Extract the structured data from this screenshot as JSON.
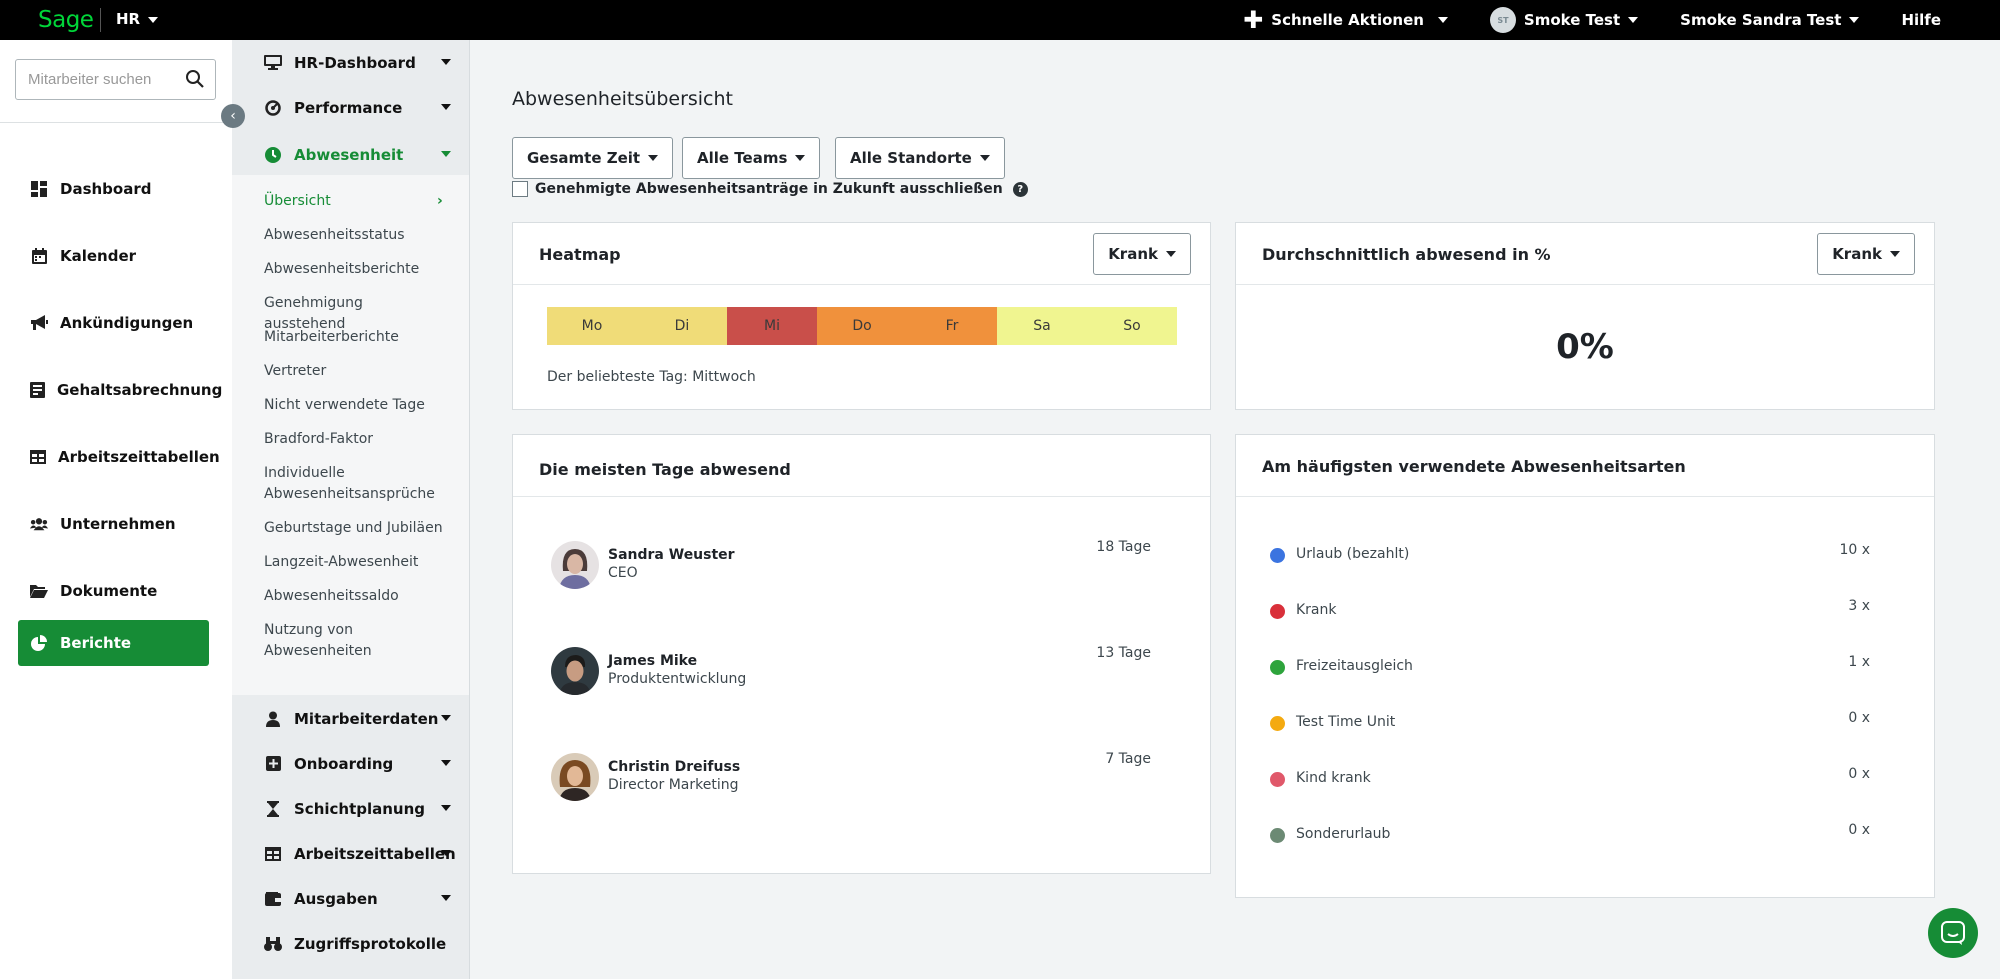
{
  "topbar": {
    "logo": "Sage",
    "module": "HR",
    "quick_actions": "Schnelle Aktionen",
    "company_initials": "ST",
    "company": "Smoke Test",
    "user": "Smoke Sandra Test",
    "help": "Hilfe"
  },
  "search": {
    "placeholder": "Mitarbeiter suchen"
  },
  "leftnav": {
    "items": [
      {
        "label": "Dashboard"
      },
      {
        "label": "Kalender"
      },
      {
        "label": "Ankündigungen"
      },
      {
        "label": "Gehaltsabrechnung"
      },
      {
        "label": "Arbeitszeittabellen"
      },
      {
        "label": "Unternehmen"
      },
      {
        "label": "Dokumente"
      },
      {
        "label": "Berichte"
      }
    ]
  },
  "subnav": {
    "hr_dashboard": "HR-Dashboard",
    "performance": "Performance",
    "absence": "Abwesenheit",
    "links": [
      "Übersicht",
      "Abwesenheitsstatus",
      "Abwesenheitsberichte",
      "Genehmigung ausstehend",
      "Mitarbeiterberichte",
      "Vertreter",
      "Nicht verwendete Tage",
      "Bradford-Faktor",
      "Individuelle Abwesenheitsansprüche",
      "Geburtstage und Jubiläen",
      "Langzeit-Abwesenheit",
      "Abwesenheitssaldo",
      "Nutzung von Abwesenheiten"
    ],
    "employee_data": "Mitarbeiterdaten",
    "onboarding": "Onboarding",
    "shift_planning": "Schichtplanung",
    "timesheets": "Arbeitszeittabellen",
    "expenses": "Ausgaben",
    "access_logs": "Zugriffsprotokolle"
  },
  "main": {
    "title": "Abwesenheitsübersicht",
    "filters": {
      "time": "Gesamte Zeit",
      "teams": "Alle Teams",
      "locations": "Alle Standorte"
    },
    "exclude_label": "Genehmigte Abwesenheitsanträge in Zukunft ausschließen",
    "heatmap": {
      "title": "Heatmap",
      "select": "Krank",
      "days": [
        {
          "label": "Mo",
          "color": "#f0dc78"
        },
        {
          "label": "Di",
          "color": "#f0dc78"
        },
        {
          "label": "Mi",
          "color": "#c94f4a"
        },
        {
          "label": "Do",
          "color": "#f0913c"
        },
        {
          "label": "Fr",
          "color": "#f0913c"
        },
        {
          "label": "Sa",
          "color": "#f0f590"
        },
        {
          "label": "So",
          "color": "#f0f590"
        }
      ],
      "favorite": "Der beliebteste Tag: Mittwoch"
    },
    "average": {
      "title": "Durchschnittlich abwesend in %",
      "select": "Krank",
      "value": "0%"
    },
    "most_days": {
      "title": "Die meisten Tage abwesend",
      "people": [
        {
          "name": "Sandra Weuster",
          "role": "CEO",
          "days": "18 Tage"
        },
        {
          "name": "James Mike",
          "role": "Produktentwicklung",
          "days": "13 Tage"
        },
        {
          "name": "Christin Dreifuss",
          "role": "Director Marketing",
          "days": "7 Tage"
        }
      ]
    },
    "types": {
      "title": "Am häufigsten verwendete Abwesenheitsarten",
      "items": [
        {
          "label": "Urlaub (bezahlt)",
          "count": "10 x",
          "color": "#3b74e0"
        },
        {
          "label": "Krank",
          "count": "3 x",
          "color": "#d9303a"
        },
        {
          "label": "Freizeitausgleich",
          "count": "1 x",
          "color": "#2ea43c"
        },
        {
          "label": "Test Time Unit",
          "count": "0 x",
          "color": "#f4aa10"
        },
        {
          "label": "Kind krank",
          "count": "0 x",
          "color": "#e0586a"
        },
        {
          "label": "Sonderurlaub",
          "count": "0 x",
          "color": "#6c8a74"
        }
      ]
    }
  }
}
